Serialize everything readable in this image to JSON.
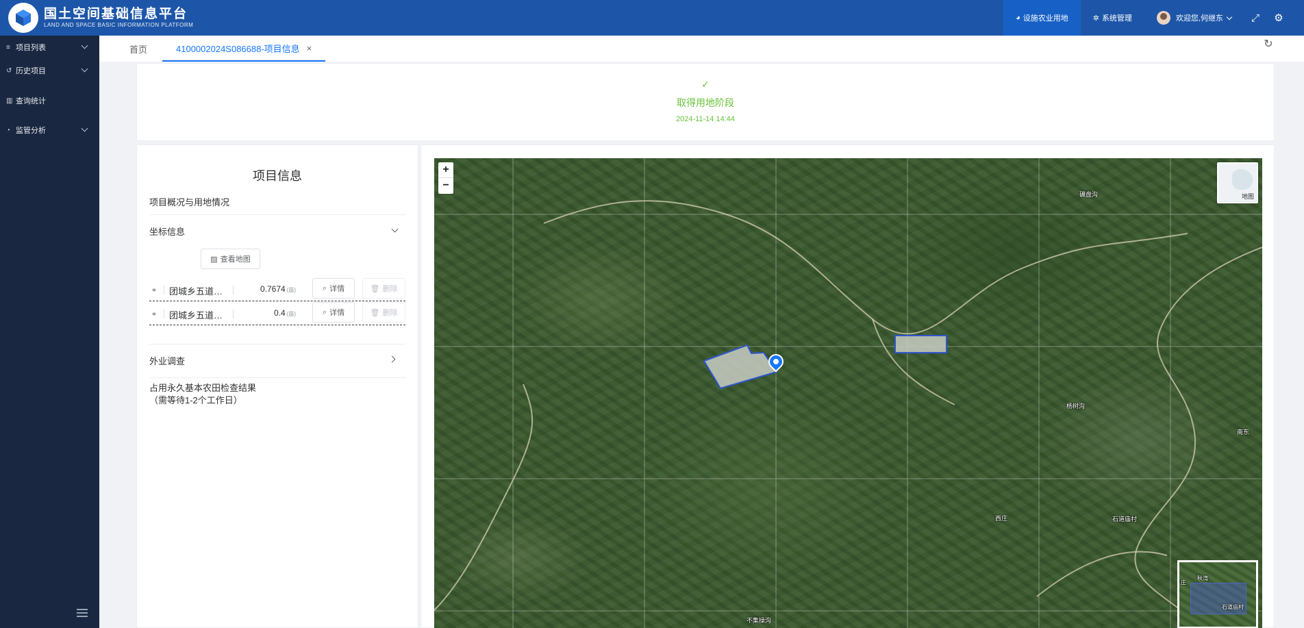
{
  "header": {
    "logo_cn": "国土空间基础信息平台",
    "logo_en": "LAND AND SPACE BASIC INFORMATION PLATFORM",
    "nav": [
      {
        "label": "设施农业用地",
        "icon": "globe-icon",
        "active": true
      },
      {
        "label": "系统管理",
        "icon": "settings-icon",
        "active": false
      }
    ],
    "user_greeting": "欢迎您,何继东",
    "colors": {
      "header_bg": "#1d56a8",
      "active_nav_bg": "#1761c6"
    }
  },
  "sidebar": {
    "items": [
      {
        "label": "项目列表",
        "icon": "list-icon",
        "has_children": true
      },
      {
        "label": "历史项目",
        "icon": "history-icon",
        "has_children": true
      },
      {
        "label": "查询统计",
        "icon": "bar-chart-icon",
        "has_children": false
      },
      {
        "label": "监管分析",
        "icon": "pie-chart-icon",
        "has_children": true
      }
    ],
    "bg": "#1a2740"
  },
  "tabs": [
    {
      "label": "首页",
      "active": false
    },
    {
      "label": "4100002024S086688-项目信息",
      "active": true,
      "closable": true
    }
  ],
  "status": {
    "stage": "取得用地阶段",
    "time": "2024-11-14 14:44",
    "color": "#67c23a"
  },
  "info": {
    "title": "项目信息",
    "overview_label": "项目概况与用地情况",
    "coord_label": "坐标信息",
    "view_map_label": "查看地图",
    "coords": [
      {
        "name": "团城乡五道庙村",
        "area": "0.7674",
        "unit": "(亩)",
        "detail_label": "详情",
        "delete_label": "删除"
      },
      {
        "name": "团城乡五道庙村",
        "area": "0.4",
        "unit": "(亩)",
        "detail_label": "详情",
        "delete_label": "删除"
      }
    ],
    "field_survey_label": "外业调查",
    "check_result_line1": "占用永久基本农田检查结果",
    "check_result_line2": "（需等待1-2个工作日）"
  },
  "map": {
    "zoom_in": "+",
    "zoom_out": "−",
    "layer_switch_label": "地图",
    "labels": [
      "碾盘沟",
      "杨树沟",
      "西庄",
      "石道庙村",
      "不集操沟",
      "南东"
    ],
    "overview_labels": [
      "秋湾",
      "石道庙村",
      "庄"
    ],
    "polygon_fill": "#c8cdc3",
    "polygon_stroke": "#2f56d0"
  }
}
